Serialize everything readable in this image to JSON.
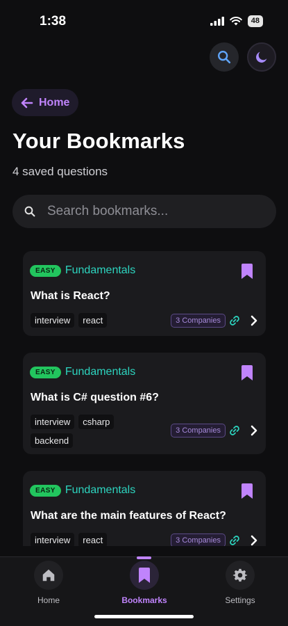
{
  "status": {
    "time": "1:38",
    "battery": "48"
  },
  "top_actions": {
    "search_icon": "search-icon",
    "theme_icon": "moon-icon"
  },
  "back": {
    "label": "Home",
    "icon": "arrow-left-icon"
  },
  "header": {
    "title": "Your Bookmarks",
    "subtitle": "4 saved questions"
  },
  "search": {
    "placeholder": "Search bookmarks..."
  },
  "cards": [
    {
      "difficulty": "EASY",
      "category": "Fundamentals",
      "title": "What is React?",
      "tags": [
        "interview",
        "react"
      ],
      "companies": "3 Companies"
    },
    {
      "difficulty": "EASY",
      "category": "Fundamentals",
      "title": "What is C# question #6?",
      "tags": [
        "interview",
        "csharp",
        "backend"
      ],
      "companies": "3 Companies"
    },
    {
      "difficulty": "EASY",
      "category": "Fundamentals",
      "title": "What are the main features of React?",
      "tags": [
        "interview",
        "react"
      ],
      "companies": "3 Companies"
    }
  ],
  "nav": {
    "items": [
      {
        "label": "Home",
        "icon": "home-icon"
      },
      {
        "label": "Bookmarks",
        "icon": "bookmark-icon"
      },
      {
        "label": "Settings",
        "icon": "gear-icon"
      }
    ],
    "active": "Bookmarks"
  },
  "colors": {
    "accent": "#c084fc",
    "easy": "#22c55e",
    "category": "#2dd4bf",
    "background": "#0e0e10"
  }
}
